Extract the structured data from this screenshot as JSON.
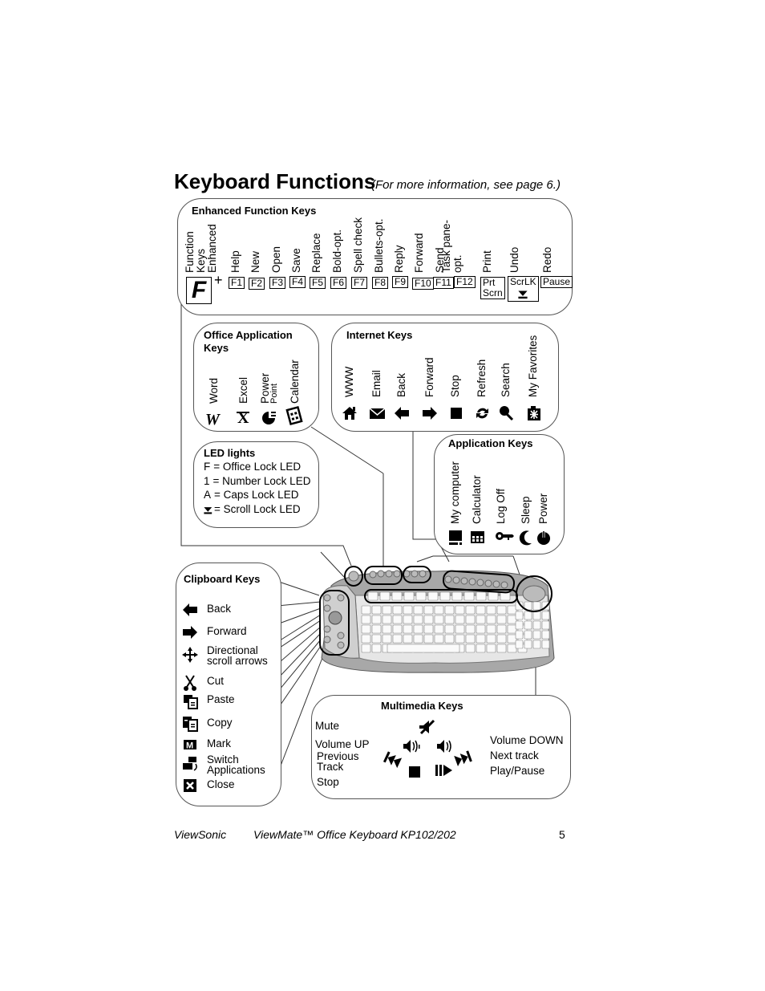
{
  "header": {
    "title": "Keyboard Functions",
    "subtitle": "(For more information, see page 6.)"
  },
  "enhanced_function_keys": {
    "title": "Enhanced Function Keys",
    "modifier_label": "Function Keys Enhanced",
    "modifier_label_lines": [
      "Function",
      "Keys",
      "Enhanced"
    ],
    "modifier_key": "F",
    "plus": "+",
    "keys": [
      {
        "function": "Help",
        "key": "F1"
      },
      {
        "function": "New",
        "key": "F2"
      },
      {
        "function": "Open",
        "key": "F3"
      },
      {
        "function": "Save",
        "key": "F4"
      },
      {
        "function": "Replace",
        "key": "F5"
      },
      {
        "function": "Bold-opt.",
        "key": "F6"
      },
      {
        "function": "Spell check",
        "key": "F7"
      },
      {
        "function": "Bullets-opt.",
        "key": "F8"
      },
      {
        "function": "Reply",
        "key": "F9"
      },
      {
        "function": "Forward",
        "key": "F10"
      },
      {
        "function": "Send",
        "key": "F11"
      },
      {
        "function": "Task pane-opt.",
        "function_lines": [
          "Task pane-",
          "opt."
        ],
        "key": "F12"
      },
      {
        "function": "Print",
        "key": "Prt Scrn",
        "key_lines": [
          "Prt",
          "Scrn"
        ]
      },
      {
        "function": "Undo",
        "key": "ScrLK",
        "key_icon": "scroll-lock-icon"
      },
      {
        "function": "Redo",
        "key": "Pause"
      }
    ]
  },
  "office_application_keys": {
    "title": "Office Application Keys",
    "title_lines": [
      "Office Application",
      "Keys"
    ],
    "keys": [
      {
        "label": "Word",
        "icon": "word-icon"
      },
      {
        "label": "Excel",
        "icon": "excel-icon"
      },
      {
        "label": "Power Point",
        "label_lines": [
          "Power",
          "Point"
        ],
        "icon": "powerpoint-icon"
      },
      {
        "label": "Calendar",
        "icon": "calendar-icon"
      }
    ]
  },
  "internet_keys": {
    "title": "Internet Keys",
    "keys": [
      {
        "label": "WWW",
        "icon": "home-icon"
      },
      {
        "label": "Email",
        "icon": "envelope-icon"
      },
      {
        "label": "Back",
        "icon": "arrow-left-icon"
      },
      {
        "label": "Forward",
        "icon": "arrow-right-icon"
      },
      {
        "label": "Stop",
        "icon": "stop-square-icon"
      },
      {
        "label": "Refresh",
        "icon": "refresh-icon"
      },
      {
        "label": "Search",
        "icon": "magnifier-icon"
      },
      {
        "label": "My Favorites",
        "icon": "favorites-folder-icon"
      }
    ]
  },
  "led_lights": {
    "title": "LED lights",
    "items": [
      {
        "key": "F",
        "text": "= Office Lock LED"
      },
      {
        "key": "1",
        "text": "= Number Lock LED"
      },
      {
        "key": "A",
        "text": "= Caps Lock LED"
      },
      {
        "key_icon": "scroll-lock-icon",
        "text": "= Scroll Lock LED"
      }
    ]
  },
  "application_keys": {
    "title": "Application Keys",
    "keys": [
      {
        "label": "My computer",
        "icon": "computer-icon"
      },
      {
        "label": "Calculator",
        "icon": "calculator-icon"
      },
      {
        "label": "Log Off",
        "icon": "key-icon"
      },
      {
        "label": "Sleep",
        "icon": "moon-icon"
      },
      {
        "label": "Power",
        "icon": "power-icon"
      }
    ]
  },
  "clipboard_keys": {
    "title": "Clipboard Keys",
    "items": [
      {
        "label": "Back",
        "icon": "arrow-left-icon"
      },
      {
        "label": "Forward",
        "icon": "arrow-right-icon"
      },
      {
        "label": "Directional scroll arrows",
        "label_lines": [
          "Directional",
          "scroll arrows"
        ],
        "icon": "directional-arrows-icon"
      },
      {
        "label": "Cut",
        "icon": "scissors-icon"
      },
      {
        "label": "Paste",
        "icon": "paste-icon"
      },
      {
        "label": "Copy",
        "icon": "copy-icon"
      },
      {
        "label": "Mark",
        "icon": "mark-icon"
      },
      {
        "label": "Switch Applications",
        "label_lines": [
          "Switch",
          "Applications"
        ],
        "icon": "switch-apps-icon"
      },
      {
        "label": "Close",
        "icon": "close-box-icon"
      }
    ]
  },
  "multimedia_keys": {
    "title": "Multimedia Keys",
    "items": [
      {
        "label": "Mute",
        "icon": "mute-icon"
      },
      {
        "label": "Volume UP",
        "icon": "volume-up-icon"
      },
      {
        "label": "Volume DOWN",
        "icon": "volume-down-icon"
      },
      {
        "label": "Previous Track",
        "label_lines": [
          "Previous",
          "Track"
        ],
        "icon": "previous-track-icon"
      },
      {
        "label": "Next track",
        "icon": "next-track-icon"
      },
      {
        "label": "Stop",
        "icon": "stop-square-icon"
      },
      {
        "label": "Play/Pause",
        "icon": "play-pause-icon"
      }
    ]
  },
  "keyboard_image": {
    "alt": "ViewMate Office Keyboard illustration"
  },
  "footer": {
    "brand": "ViewSonic",
    "product": "ViewMate™ Office Keyboard KP102/202",
    "page_number": "5"
  }
}
